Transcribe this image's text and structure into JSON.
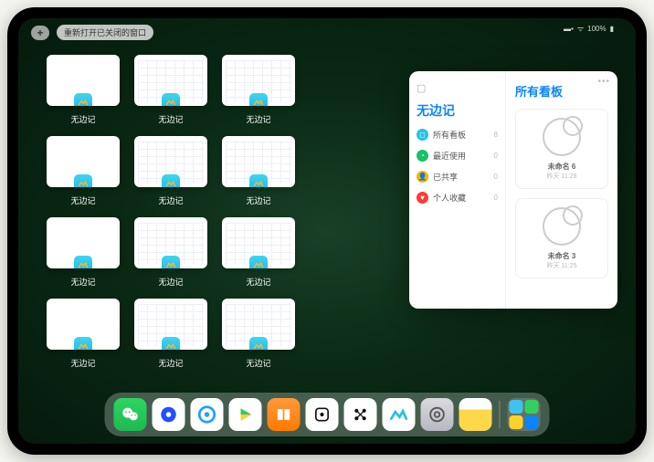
{
  "topbar": {
    "plus": "+",
    "reopen_label": "重新打开已关闭的窗口"
  },
  "status": {
    "signal": "▬▪",
    "wifi": "ᯤ",
    "battery_text": "100%",
    "battery": "▮"
  },
  "apps": [
    {
      "label": "无边记",
      "thumb": "blank"
    },
    {
      "label": "无边记",
      "thumb": "calendar"
    },
    {
      "label": "无边记",
      "thumb": "calendar"
    },
    {
      "label": "",
      "thumb": "none"
    },
    {
      "label": "无边记",
      "thumb": "blank"
    },
    {
      "label": "无边记",
      "thumb": "calendar"
    },
    {
      "label": "无边记",
      "thumb": "calendar"
    },
    {
      "label": "",
      "thumb": "none"
    },
    {
      "label": "无边记",
      "thumb": "blank"
    },
    {
      "label": "无边记",
      "thumb": "calendar"
    },
    {
      "label": "无边记",
      "thumb": "calendar"
    },
    {
      "label": "",
      "thumb": "none"
    },
    {
      "label": "无边记",
      "thumb": "blank"
    },
    {
      "label": "无边记",
      "thumb": "calendar"
    },
    {
      "label": "无边记",
      "thumb": "calendar"
    },
    {
      "label": "",
      "thumb": "none"
    }
  ],
  "panel": {
    "left_title": "无边记",
    "more": "•••",
    "menu": [
      {
        "icon_bg": "#22c3e6",
        "icon": "◻",
        "label": "所有看板",
        "count": "8"
      },
      {
        "icon_bg": "#18c06a",
        "icon": "◔",
        "label": "最近使用",
        "count": "0"
      },
      {
        "icon_bg": "#f5b301",
        "icon": "👤",
        "label": "已共享",
        "count": "0"
      },
      {
        "icon_bg": "#ff3b30",
        "icon": "♥",
        "label": "个人收藏",
        "count": "0"
      }
    ],
    "right_title": "所有看板",
    "boards": [
      {
        "name": "未命名 6",
        "time": "昨天 11:28"
      },
      {
        "name": "未命名 3",
        "time": "昨天 11:25"
      }
    ]
  },
  "dock": {
    "main": [
      {
        "name": "wechat",
        "bg": "linear-gradient(#2dd65f,#1db954)",
        "glyph_color": "#fff"
      },
      {
        "name": "browser1",
        "bg": "#fff"
      },
      {
        "name": "browser2",
        "bg": "#fff"
      },
      {
        "name": "play",
        "bg": "#fff"
      },
      {
        "name": "books",
        "bg": "linear-gradient(#ff9a3c,#ff7a00)",
        "glyph_color": "#fff"
      },
      {
        "name": "dice",
        "bg": "#fff"
      },
      {
        "name": "dots",
        "bg": "#fff"
      },
      {
        "name": "freeform",
        "bg": "#fff"
      },
      {
        "name": "settings",
        "bg": "linear-gradient(#d9d9de,#b8b8c2)",
        "glyph_color": "#555"
      },
      {
        "name": "notes",
        "bg": "linear-gradient(#fff 0%,#fff 35%,#ffd84a 35%,#ffd84a 100%)"
      }
    ]
  }
}
